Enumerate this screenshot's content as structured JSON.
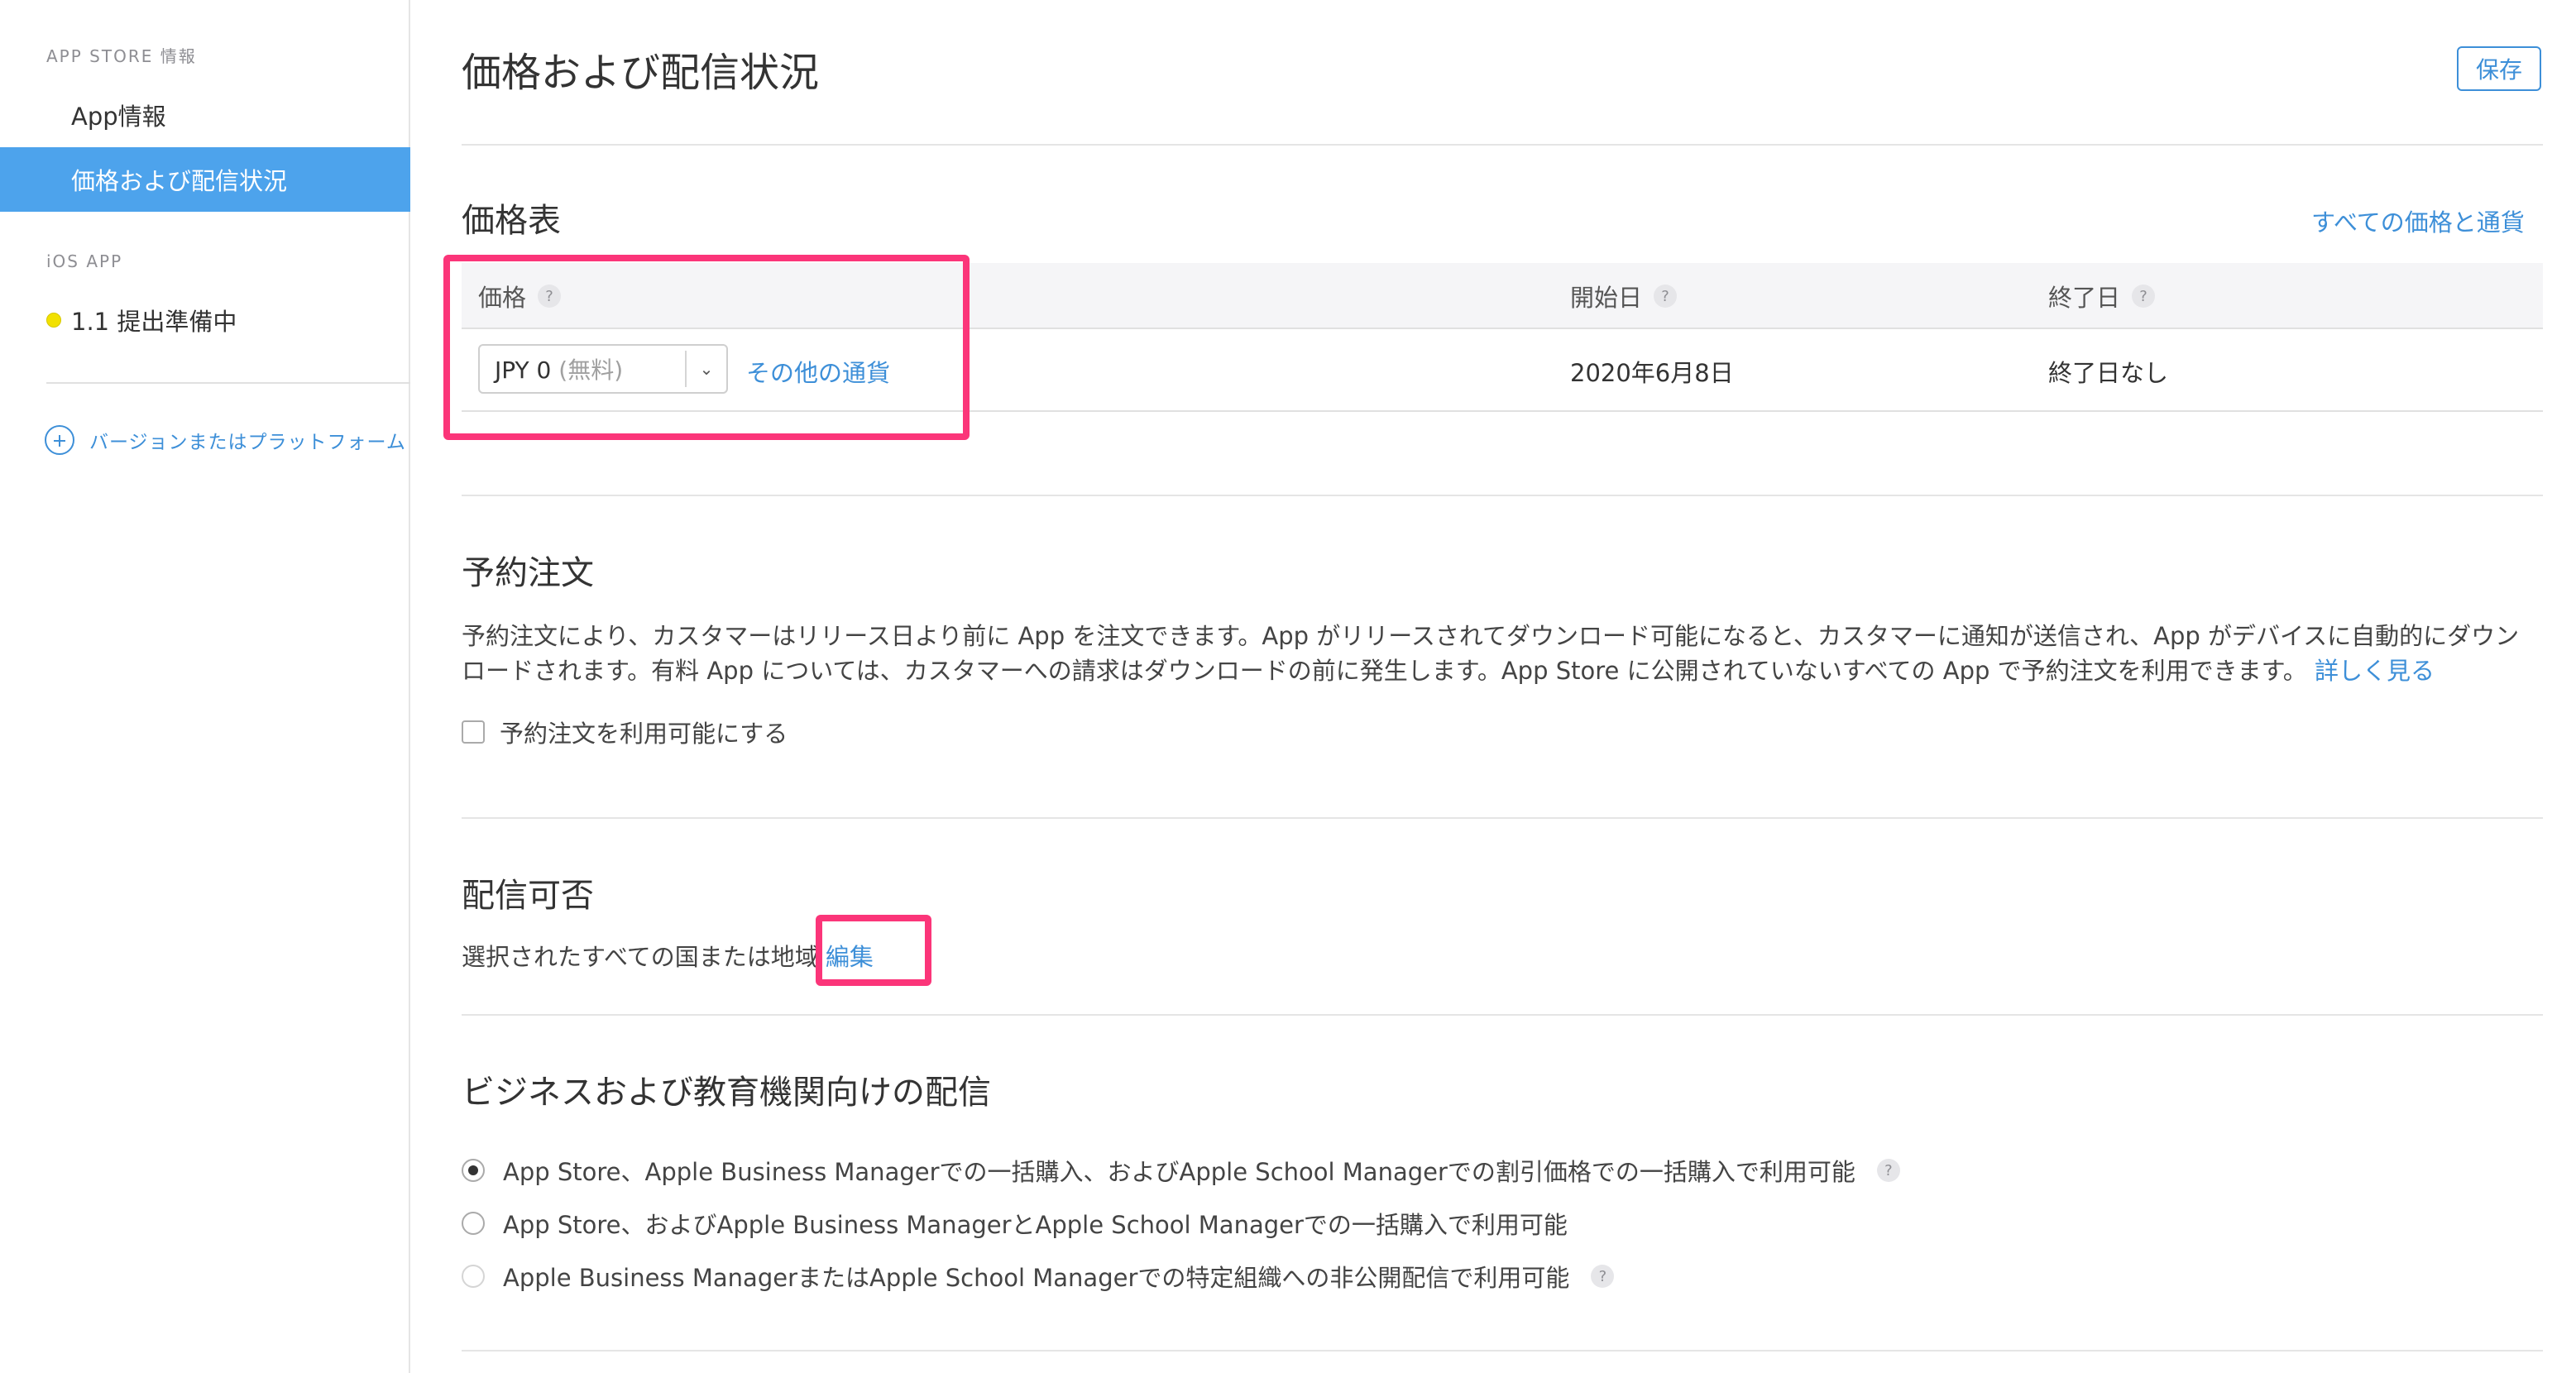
{
  "sidebar": {
    "app_store_section": "APP STORE 情報",
    "items": [
      {
        "label": "App情報"
      },
      {
        "label": "価格および配信状況",
        "active": true
      }
    ],
    "ios_section": "iOS APP",
    "version_label": "1.1 提出準備中",
    "add_label": "バージョンまたはプラットフォーム"
  },
  "header": {
    "title": "価格および配信状況",
    "save_label": "保存"
  },
  "price_table": {
    "title": "価格表",
    "all_prices_link": "すべての価格と通貨",
    "columns": [
      "価格",
      "開始日",
      "終了日"
    ],
    "help": "?",
    "row": {
      "price_value": "JPY 0",
      "price_note": "(無料)",
      "other_currency": "その他の通貨",
      "start_date": "2020年6月8日",
      "end_date": "終了日なし"
    }
  },
  "preorder": {
    "title": "予約注文",
    "description": "予約注文により、カスタマーはリリース日より前に App を注文できます。App がリリースされてダウンロード可能になると、カスタマーに通知が送信され、App がデバイスに自動的にダウンロードされます。有料 App については、カスタマーへの請求はダウンロードの前に発生します。App Store に公開されていないすべての App で予約注文を利用できます。",
    "learn_more": "詳しく見る",
    "checkbox_label": "予約注文を利用可能にする"
  },
  "availability": {
    "title": "配信可否",
    "text": "選択されたすべての国または地域",
    "edit_link": "編集"
  },
  "business": {
    "title": "ビジネスおよび教育機関向けの配信",
    "options": [
      {
        "label": "App Store、Apple Business Managerでの一括購入、およびApple School Managerでの割引価格での一括購入で利用可能",
        "selected": true
      },
      {
        "label": "App Store、およびApple Business ManagerとApple School Managerでの一括購入で利用可能",
        "selected": false
      },
      {
        "label": "Apple Business ManagerまたはApple School Managerでの特定組織への非公開配信で利用可能",
        "selected": false
      }
    ]
  },
  "colors": {
    "accent": "#3d8fd8",
    "sidebar_active": "#4da3ec",
    "highlight": "#fb3579",
    "status_dot": "#f2e100"
  }
}
